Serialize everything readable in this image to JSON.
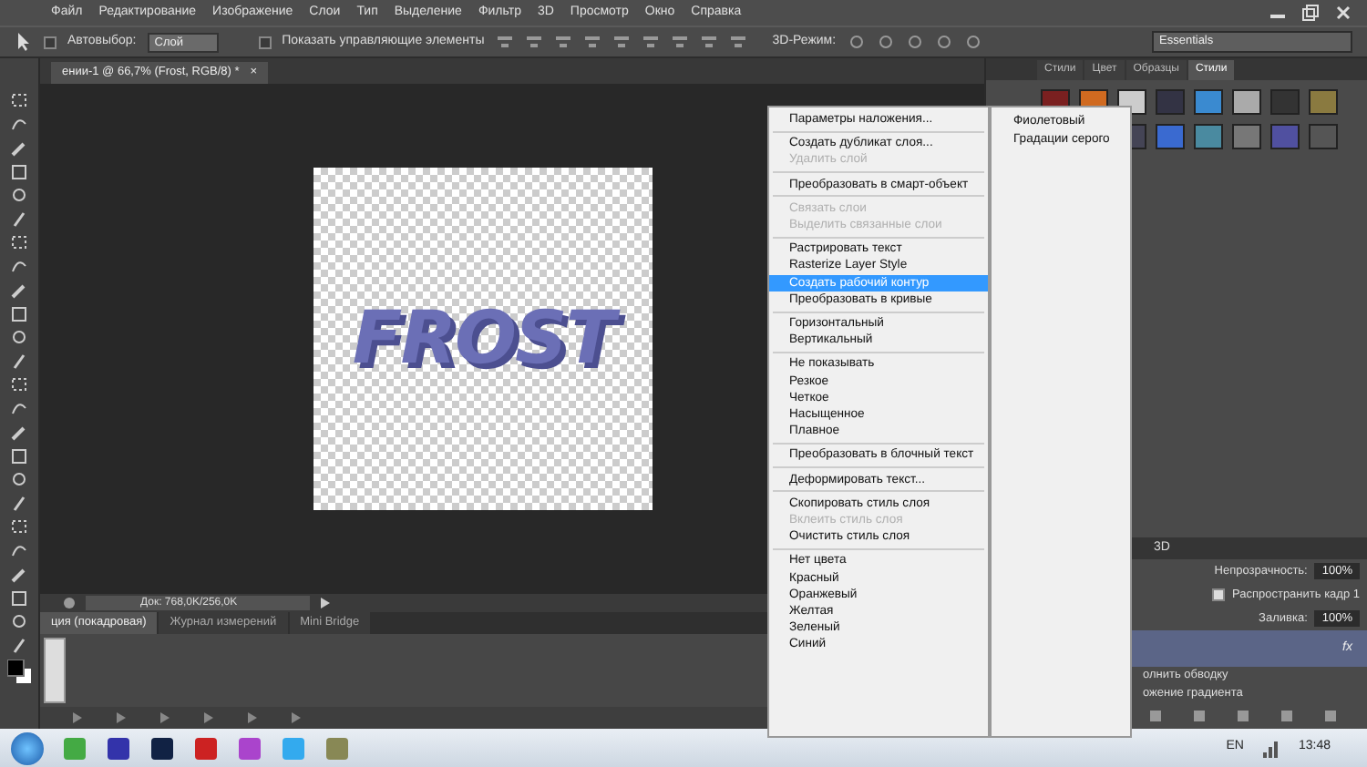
{
  "menubar": [
    "Файл",
    "Редактирование",
    "Изображение",
    "Слои",
    "Тип",
    "Выделение",
    "Фильтр",
    "3D",
    "Просмотр",
    "Окно",
    "Справка"
  ],
  "options_bar": {
    "auto_select_label": "Автовыбор:",
    "auto_select_checked": false,
    "auto_select_value": "Слой",
    "show_controls_label": "Показать управляющие элементы",
    "show_controls_checked": false,
    "mode_3d_label": "3D-Режим:"
  },
  "workspace": "Essentials",
  "document_tab": {
    "title": "ении-1 @ 66,7% (Frost, RGB/8) *",
    "close": "×"
  },
  "canvas": {
    "text": "FROST"
  },
  "status_bar": {
    "doc_size": "Док: 768,0K/256,0K"
  },
  "bottom_tabs": [
    {
      "label": "ция (покадровая)",
      "selected": true
    },
    {
      "label": "Журнал измерений",
      "selected": false
    },
    {
      "label": "Mini Bridge",
      "selected": false
    }
  ],
  "context_menu": [
    {
      "kind": "item",
      "label": "Параметры наложения...",
      "disabled": false,
      "selected": false
    },
    {
      "kind": "separator"
    },
    {
      "kind": "item",
      "label": "Создать дубликат слоя...",
      "disabled": false,
      "selected": false
    },
    {
      "kind": "item",
      "label": "Удалить слой",
      "disabled": true,
      "selected": false
    },
    {
      "kind": "separator"
    },
    {
      "kind": "item",
      "label": "Преобразовать в смарт-объект",
      "disabled": false,
      "selected": false
    },
    {
      "kind": "separator"
    },
    {
      "kind": "item",
      "label": "Связать слои",
      "disabled": true,
      "selected": false
    },
    {
      "kind": "item",
      "label": "Выделить связанные слои",
      "disabled": true,
      "selected": false
    },
    {
      "kind": "separator"
    },
    {
      "kind": "item",
      "label": "Растрировать текст",
      "disabled": false,
      "selected": false
    },
    {
      "kind": "item",
      "label": "Rasterize Layer Style",
      "disabled": false,
      "selected": false
    },
    {
      "kind": "item",
      "label": "Создать рабочий контур",
      "disabled": false,
      "selected": true
    },
    {
      "kind": "item",
      "label": "Преобразовать в кривые",
      "disabled": false,
      "selected": false
    },
    {
      "kind": "separator"
    },
    {
      "kind": "item",
      "label": "Горизонтальный",
      "disabled": false,
      "selected": false
    },
    {
      "kind": "item",
      "label": "Вертикальный",
      "disabled": false,
      "selected": false
    },
    {
      "kind": "separator"
    },
    {
      "kind": "item",
      "label": "Не показывать",
      "disabled": false,
      "selected": false
    },
    {
      "kind": "item",
      "label": "Резкое",
      "disabled": false,
      "selected": false
    },
    {
      "kind": "item",
      "label": "Четкое",
      "disabled": false,
      "selected": false
    },
    {
      "kind": "item",
      "label": "Насыщенное",
      "disabled": false,
      "selected": false
    },
    {
      "kind": "item",
      "label": "Плавное",
      "disabled": false,
      "selected": false
    },
    {
      "kind": "separator"
    },
    {
      "kind": "item",
      "label": "Преобразовать в блочный текст",
      "disabled": false,
      "selected": false
    },
    {
      "kind": "separator"
    },
    {
      "kind": "item",
      "label": "Деформировать текст...",
      "disabled": false,
      "selected": false
    },
    {
      "kind": "separator"
    },
    {
      "kind": "item",
      "label": "Скопировать стиль слоя",
      "disabled": false,
      "selected": false
    },
    {
      "kind": "item",
      "label": "Вклеить стиль слоя",
      "disabled": true,
      "selected": false
    },
    {
      "kind": "item",
      "label": "Очистить стиль слоя",
      "disabled": false,
      "selected": false
    },
    {
      "kind": "separator"
    },
    {
      "kind": "item",
      "label": "Нет цвета",
      "disabled": false,
      "selected": false
    },
    {
      "kind": "item",
      "label": "Красный",
      "disabled": false,
      "selected": false
    },
    {
      "kind": "item",
      "label": "Оранжевый",
      "disabled": false,
      "selected": false
    },
    {
      "kind": "item",
      "label": "Желтая",
      "disabled": false,
      "selected": false
    },
    {
      "kind": "item",
      "label": "Зеленый",
      "disabled": false,
      "selected": false
    },
    {
      "kind": "item",
      "label": "Синий",
      "disabled": false,
      "selected": false
    }
  ],
  "submenu": [
    "Фиолетовый",
    "Градации серого"
  ],
  "right_panel": {
    "tabs": [
      {
        "label": "Стили",
        "selected": false
      },
      {
        "label": "Цвет",
        "selected": false
      },
      {
        "label": "Образцы",
        "selected": false
      },
      {
        "label": "Стили",
        "selected": true
      }
    ],
    "layers_tab": "3D",
    "opacity_label": "Непрозрачность:",
    "opacity_value": "100%",
    "propagate_label": "Распространить кадр 1",
    "propagate_checked": true,
    "fill_label": "Заливка:",
    "fill_value": "100%",
    "fx": "fx",
    "effects": [
      "олнить обводку",
      "ожение градиента"
    ]
  },
  "taskbar": {
    "language": "EN",
    "time": "13:48"
  }
}
